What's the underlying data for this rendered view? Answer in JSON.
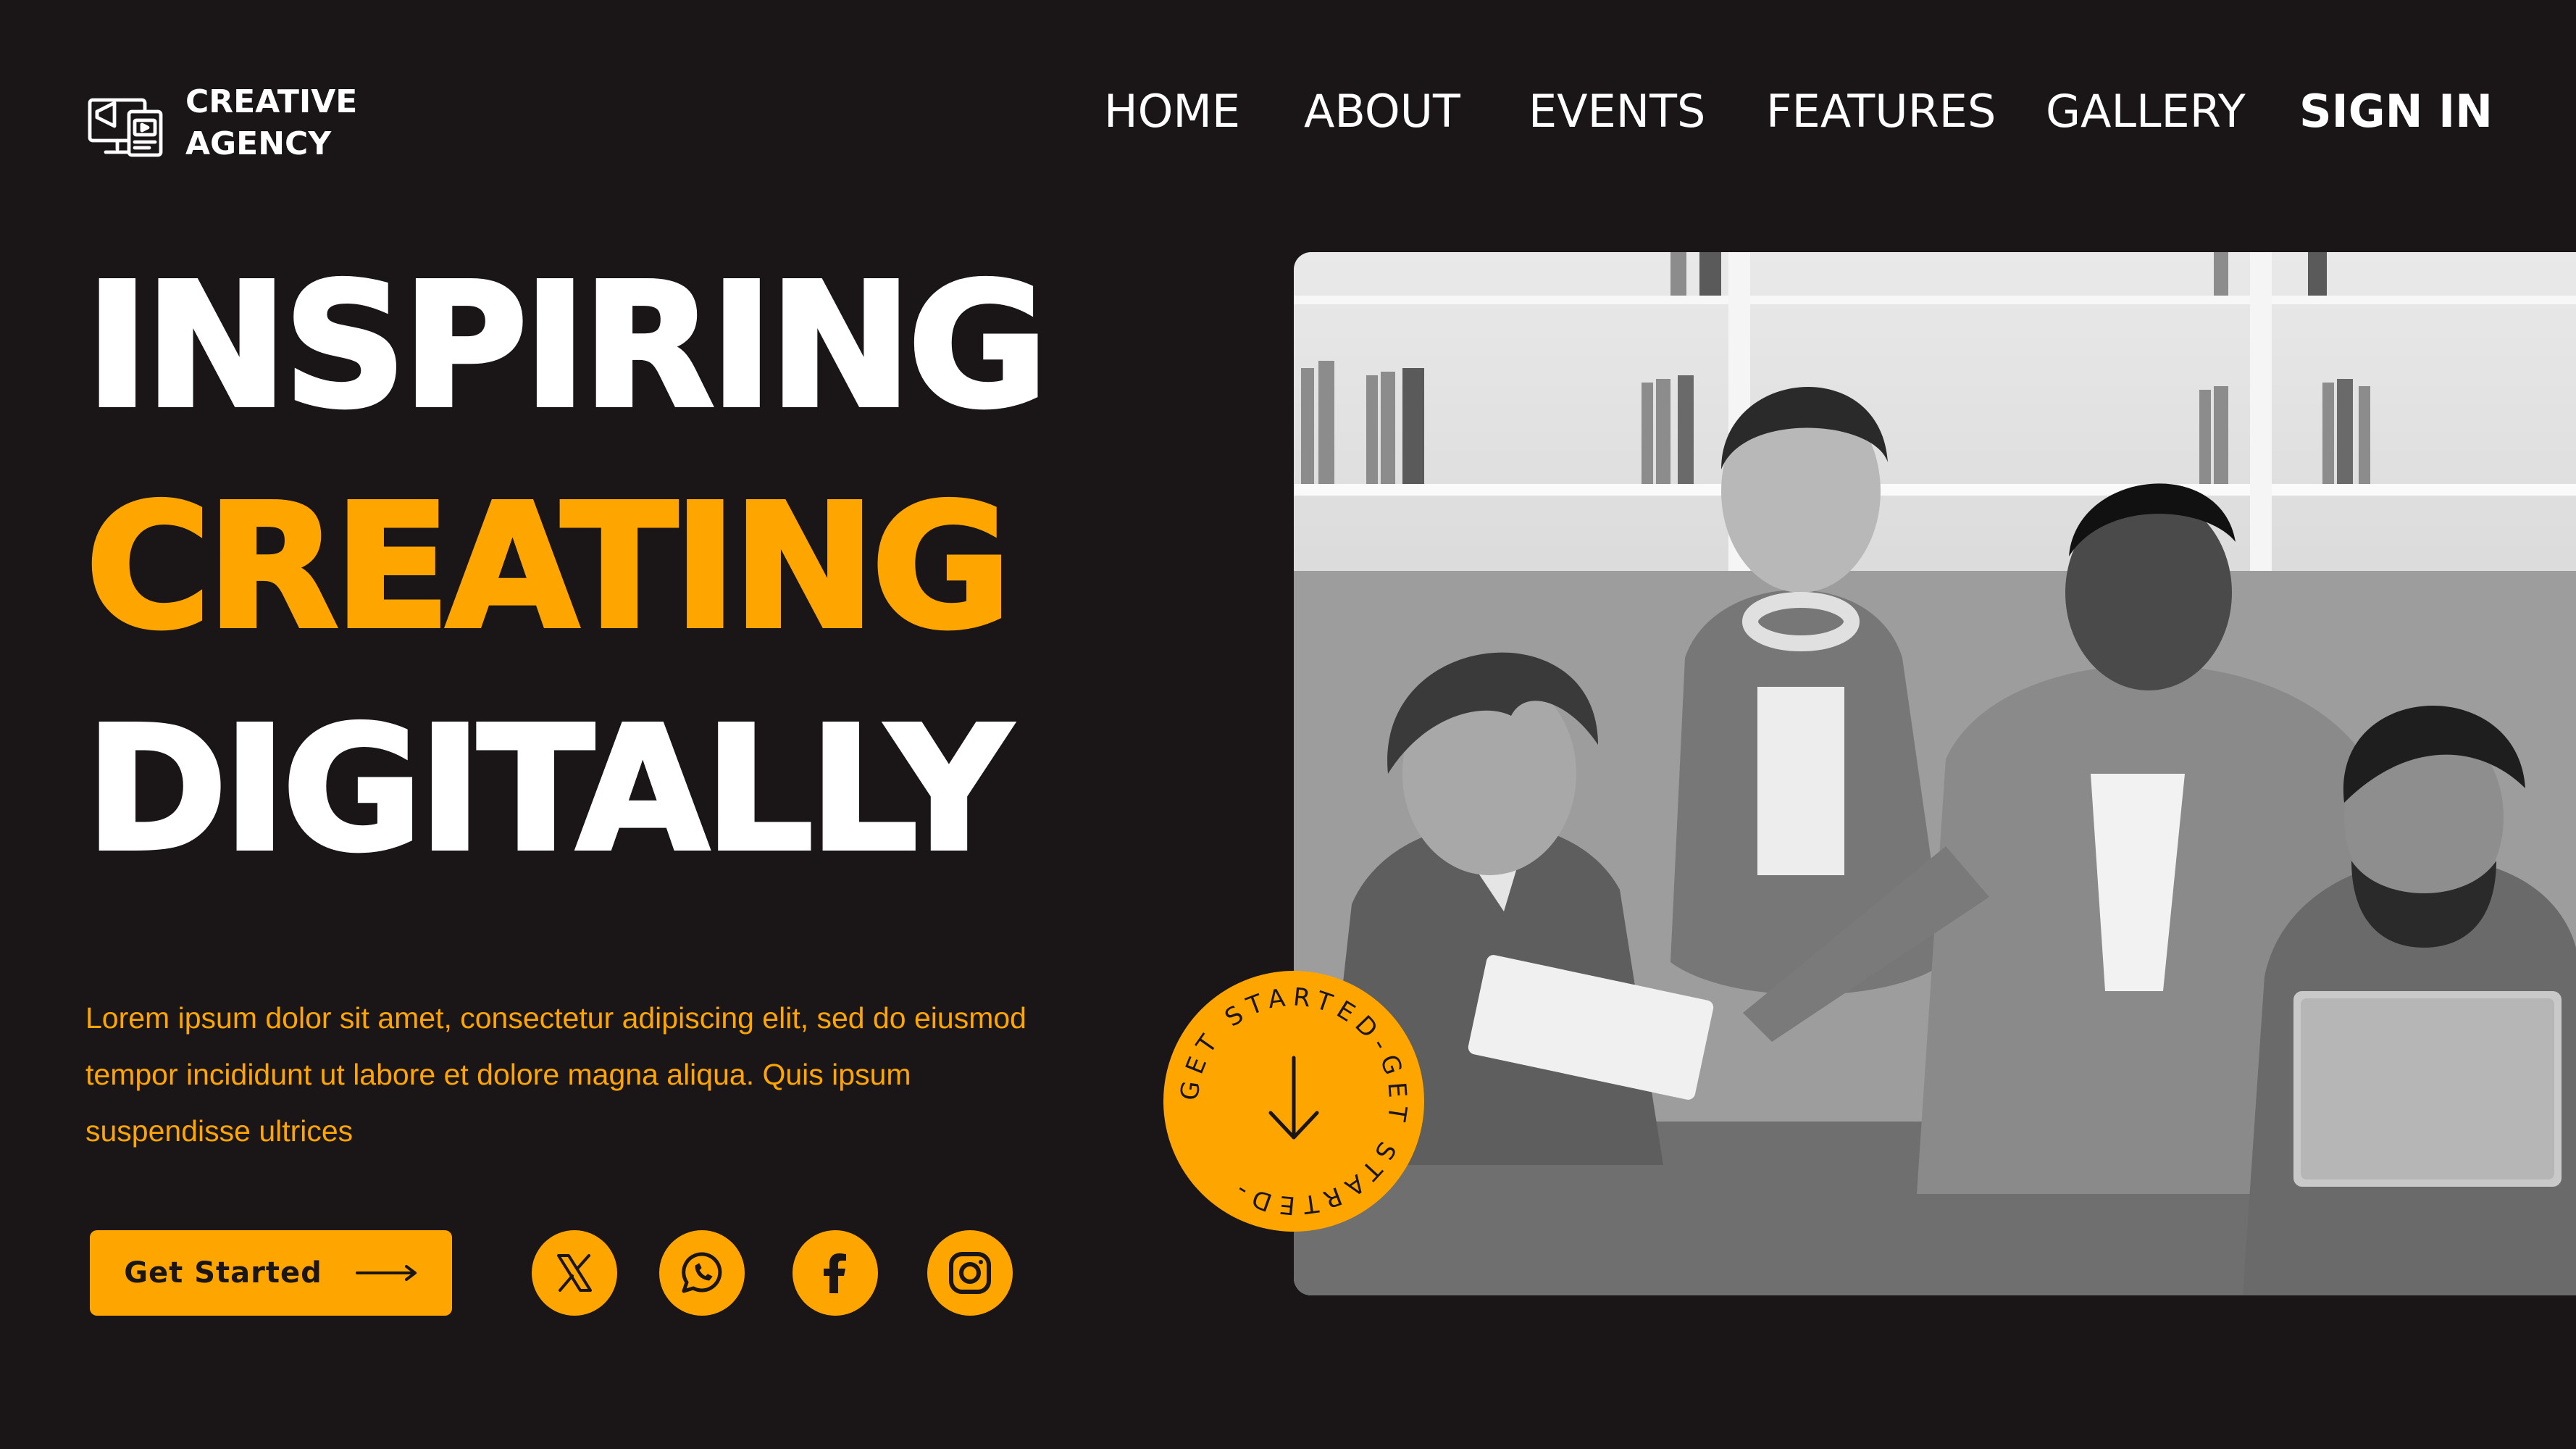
{
  "brand": {
    "line1": "CREATIVE",
    "line2": "AGENCY",
    "icon": "megaphone-screen-icon"
  },
  "nav": {
    "items": [
      {
        "label": "HOME"
      },
      {
        "label": "ABOUT"
      },
      {
        "label": "EVENTS"
      },
      {
        "label": "FEATURES"
      },
      {
        "label": "GALLERY"
      }
    ],
    "signin": "SIGN IN"
  },
  "hero": {
    "line1": "INSPIRING",
    "line2": "CREATING",
    "line3": "DIGITALLY",
    "description": "Lorem ipsum dolor sit amet, consectetur adipiscing elit, sed do eiusmod tempor incididunt ut labore et dolore magna aliqua. Quis ipsum suspendisse ultrices"
  },
  "cta": {
    "label": "Get Started",
    "icon": "arrow-right-icon"
  },
  "badge": {
    "text": "GET STARTED-GET STARTED-",
    "icon": "arrow-down-icon"
  },
  "social": [
    {
      "name": "x",
      "icon": "x-icon"
    },
    {
      "name": "whatsapp",
      "icon": "whatsapp-icon"
    },
    {
      "name": "facebook",
      "icon": "facebook-icon"
    },
    {
      "name": "instagram",
      "icon": "instagram-icon"
    }
  ],
  "colors": {
    "background": "#1a1617",
    "accent": "#ffa500",
    "text": "#ffffff"
  }
}
